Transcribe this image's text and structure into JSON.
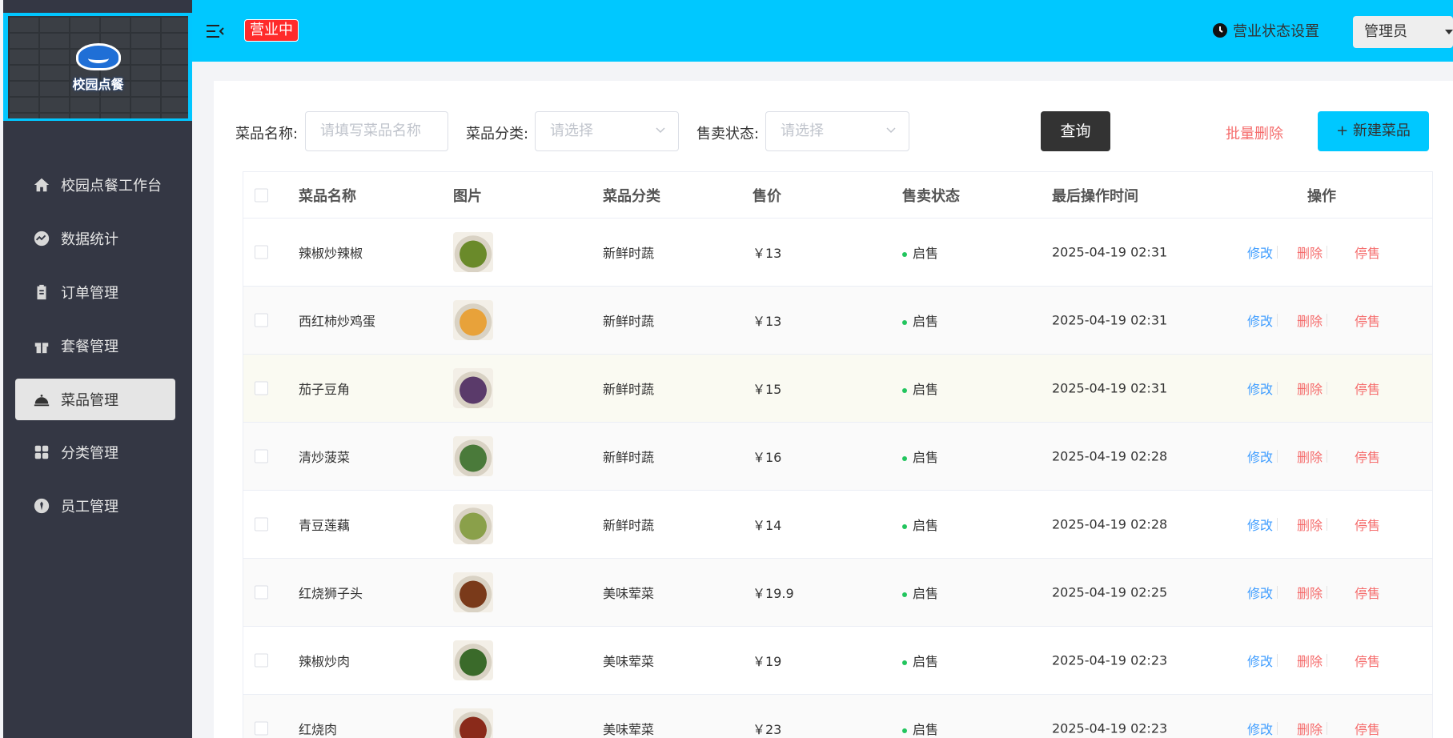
{
  "app": {
    "logo_text": "校园点餐",
    "status_tag": "营业中",
    "biz_setting_label": "营业状态设置",
    "user_label": "管理员"
  },
  "sidebar": {
    "items": [
      {
        "label": "校园点餐工作台",
        "icon": "home-icon",
        "active": false
      },
      {
        "label": "数据统计",
        "icon": "chart-icon",
        "active": false
      },
      {
        "label": "订单管理",
        "icon": "clipboard-icon",
        "active": false
      },
      {
        "label": "套餐管理",
        "icon": "gift-icon",
        "active": false
      },
      {
        "label": "菜品管理",
        "icon": "cloche-icon",
        "active": true
      },
      {
        "label": "分类管理",
        "icon": "grid-icon",
        "active": false
      },
      {
        "label": "员工管理",
        "icon": "employee-icon",
        "active": false
      }
    ]
  },
  "filters": {
    "name_label": "菜品名称:",
    "name_placeholder": "请填写菜品名称",
    "category_label": "菜品分类:",
    "category_placeholder": "请选择",
    "status_label": "售卖状态:",
    "status_placeholder": "请选择",
    "query_button": "查询",
    "batch_delete_button": "批量删除",
    "new_button": "+ 新建菜品"
  },
  "table": {
    "headers": [
      "菜品名称",
      "图片",
      "菜品分类",
      "售价",
      "售卖状态",
      "最后操作时间",
      "操作"
    ],
    "actions": {
      "edit": "修改",
      "delete": "删除",
      "stop": "停售"
    },
    "rows": [
      {
        "name": "辣椒炒辣椒",
        "category": "新鲜时蔬",
        "price": "￥13",
        "status": "启售",
        "time": "2025-04-19 02:31",
        "thumb_color": "#6a8a2a"
      },
      {
        "name": "西红柿炒鸡蛋",
        "category": "新鲜时蔬",
        "price": "￥13",
        "status": "启售",
        "time": "2025-04-19 02:31",
        "thumb_color": "#e8a23a"
      },
      {
        "name": "茄子豆角",
        "category": "新鲜时蔬",
        "price": "￥15",
        "status": "启售",
        "time": "2025-04-19 02:31",
        "thumb_color": "#5a3a6a"
      },
      {
        "name": "清炒菠菜",
        "category": "新鲜时蔬",
        "price": "￥16",
        "status": "启售",
        "time": "2025-04-19 02:28",
        "thumb_color": "#4a7a3a"
      },
      {
        "name": "青豆莲藕",
        "category": "新鲜时蔬",
        "price": "￥14",
        "status": "启售",
        "time": "2025-04-19 02:28",
        "thumb_color": "#8aa04a"
      },
      {
        "name": "红烧狮子头",
        "category": "美味荤菜",
        "price": "￥19.9",
        "status": "启售",
        "time": "2025-04-19 02:25",
        "thumb_color": "#7a3a1a"
      },
      {
        "name": "辣椒炒肉",
        "category": "美味荤菜",
        "price": "￥19",
        "status": "启售",
        "time": "2025-04-19 02:23",
        "thumb_color": "#3a6a2a"
      },
      {
        "name": "红烧肉",
        "category": "美味荤菜",
        "price": "￥23",
        "status": "启售",
        "time": "2025-04-19 02:23",
        "thumb_color": "#8a2a1a"
      }
    ]
  },
  "colors": {
    "header_bg": "#00c8ff",
    "sidebar_bg": "#343744",
    "status_dot": "#22c55e",
    "edit_link": "#419eff",
    "danger_link": "#f56c6c"
  }
}
